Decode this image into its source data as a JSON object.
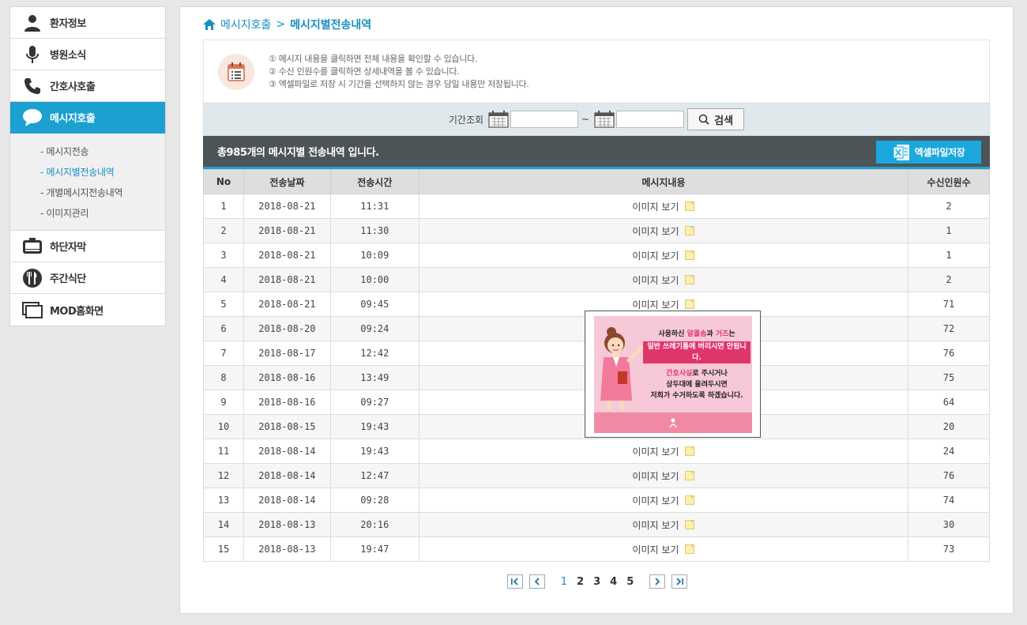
{
  "sidebar": {
    "items": [
      {
        "label": "환자정보",
        "icon": "person-icon"
      },
      {
        "label": "병원소식",
        "icon": "microphone-icon"
      },
      {
        "label": "간호사호출",
        "icon": "phone-icon"
      },
      {
        "label": "메시지호출",
        "icon": "speech-bubble-icon"
      },
      {
        "label": "하단자막",
        "icon": "tv-icon"
      },
      {
        "label": "주간식단",
        "icon": "fork-knife-icon"
      },
      {
        "label": "MOD홈화면",
        "icon": "screens-icon"
      }
    ],
    "submenu": [
      {
        "label": "- 메시지전송"
      },
      {
        "label": "- 메시지별전송내역"
      },
      {
        "label": "- 개별메시지전송내역"
      },
      {
        "label": "- 이미지관리"
      }
    ]
  },
  "breadcrumb": {
    "parent": "메시지호출",
    "separator": ">",
    "current": "메시지별전송내역"
  },
  "info": {
    "lines": [
      "① 메시지 내용을 클릭하면 전체 내용을 확인할 수 있습니다.",
      "② 수신 인원수를 클릭하면 상세내역을 볼 수 있습니다.",
      "③ 엑셀파일로 저장 시 기간을 선택하지 않는 경우 당일 내용만 저장됩니다."
    ]
  },
  "search": {
    "label": "기간조회",
    "from_value": "",
    "to_value": "",
    "tilde": "~",
    "button": "검색"
  },
  "summary": {
    "text": "총985개의 메시지별 전송내역 입니다.",
    "excel_button": "엑셀파일저장"
  },
  "table": {
    "headers": [
      "No",
      "전송날짜",
      "전송시간",
      "메시지내용",
      "수신인원수"
    ],
    "rows": [
      {
        "no": "1",
        "date": "2018-08-21",
        "time": "11:31",
        "content": "이미지 보기",
        "count": "2"
      },
      {
        "no": "2",
        "date": "2018-08-21",
        "time": "11:30",
        "content": "이미지 보기",
        "count": "1"
      },
      {
        "no": "3",
        "date": "2018-08-21",
        "time": "10:09",
        "content": "이미지 보기",
        "count": "1"
      },
      {
        "no": "4",
        "date": "2018-08-21",
        "time": "10:00",
        "content": "이미지 보기",
        "count": "2"
      },
      {
        "no": "5",
        "date": "2018-08-21",
        "time": "09:45",
        "content": "이미지 보기",
        "count": "71"
      },
      {
        "no": "6",
        "date": "2018-08-20",
        "time": "09:24",
        "content": "",
        "count": "72"
      },
      {
        "no": "7",
        "date": "2018-08-17",
        "time": "12:42",
        "content": "",
        "count": "76"
      },
      {
        "no": "8",
        "date": "2018-08-16",
        "time": "13:49",
        "content": "",
        "count": "75"
      },
      {
        "no": "9",
        "date": "2018-08-16",
        "time": "09:27",
        "content": "",
        "count": "64"
      },
      {
        "no": "10",
        "date": "2018-08-15",
        "time": "19:43",
        "content": "",
        "count": "20"
      },
      {
        "no": "11",
        "date": "2018-08-14",
        "time": "19:43",
        "content": "이미지 보기",
        "count": "24"
      },
      {
        "no": "12",
        "date": "2018-08-14",
        "time": "12:47",
        "content": "이미지 보기",
        "count": "76"
      },
      {
        "no": "13",
        "date": "2018-08-14",
        "time": "09:28",
        "content": "이미지 보기",
        "count": "74"
      },
      {
        "no": "14",
        "date": "2018-08-13",
        "time": "20:16",
        "content": "이미지 보기",
        "count": "30"
      },
      {
        "no": "15",
        "date": "2018-08-13",
        "time": "19:47",
        "content": "이미지 보기",
        "count": "73"
      }
    ]
  },
  "pager": {
    "pages": [
      "1",
      "2",
      "3",
      "4",
      "5"
    ],
    "current": "1"
  },
  "popup": {
    "line1_a": "사용하신 ",
    "line1_b": "알콜솜",
    "line1_c": "과 ",
    "line1_d": "거즈",
    "line1_e": "는",
    "line2": "일반 쓰레기통에 버리시면 안됩니다.",
    "line3_a": "간호사실",
    "line3_b": "로 주시거나",
    "line4": "상두대에 올려두시면",
    "line5": "저희가 수거하도록 하겠습니다."
  },
  "colors": {
    "accent": "#1ba0d0",
    "summary_bar": "#4d5457",
    "search_bar": "#dfe8eb"
  }
}
